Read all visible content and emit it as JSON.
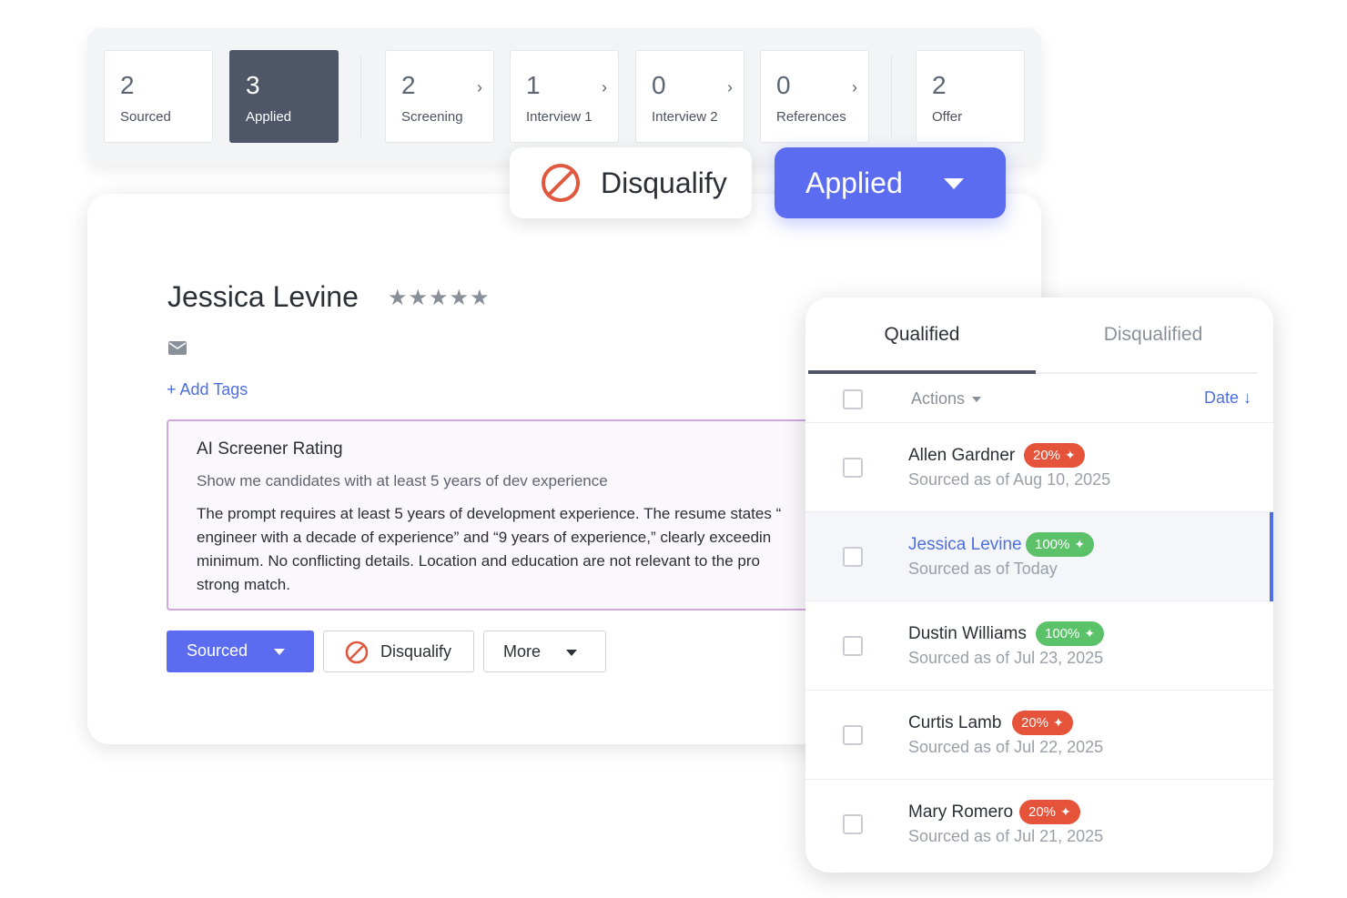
{
  "pipeline": {
    "stages": [
      {
        "count": "2",
        "label": "Sourced"
      },
      {
        "count": "3",
        "label": "Applied"
      },
      {
        "count": "2",
        "label": "Screening"
      },
      {
        "count": "1",
        "label": "Interview 1"
      },
      {
        "count": "0",
        "label": "Interview 2"
      },
      {
        "count": "0",
        "label": "References"
      },
      {
        "count": "2",
        "label": "Offer"
      }
    ],
    "chevron": "›",
    "active_stage": "Applied"
  },
  "floating": {
    "disqualify_label": "Disqualify",
    "applied_label": "Applied"
  },
  "candidate": {
    "name": "Jessica Levine",
    "stars": "★★★★★",
    "add_tags": "+ Add Tags",
    "ai": {
      "title": "AI Screener Rating",
      "prompt": "Show me candidates with at least 5 years of dev experience",
      "body": "The prompt requires at least 5 years of development experience. The resume states “\nengineer with a decade of experience” and “9 years of experience,” clearly exceedin\nminimum. No conflicting details. Location and education are not relevant to the pro\nstrong match."
    },
    "actions": {
      "sourced_label": "Sourced",
      "disqualify_label": "Disqualify",
      "more_label": "More"
    }
  },
  "list": {
    "tabs": {
      "qualified": "Qualified",
      "disqualified": "Disqualified"
    },
    "header": {
      "actions": "Actions",
      "date": "Date ↓"
    },
    "rows": [
      {
        "name": "Allen Gardner",
        "score": "20%",
        "sub": "Sourced as of Aug 10, 2025"
      },
      {
        "name": "Jessica Levine",
        "score": "100%",
        "sub": "Sourced as of Today"
      },
      {
        "name": "Dustin Williams",
        "score": "100%",
        "sub": "Sourced as of Jul 23, 2025"
      },
      {
        "name": "Curtis Lamb",
        "score": "20%",
        "sub": "Sourced as of Jul 22, 2025"
      },
      {
        "name": "Mary Romero",
        "score": "20%",
        "sub": "Sourced as of Jul 21, 2025"
      }
    ],
    "spark": "✦"
  },
  "colors": {
    "accent": "#5b6cf0",
    "link": "#4d6fe0",
    "active_stage": "#4e5668",
    "badge_low": "#e5533a",
    "badge_high": "#5cc26a",
    "disqualify_icon": "#e0583e",
    "ai_border": "#cfa9dc"
  },
  "icons": [
    "chevron-right-icon",
    "disqualify-icon",
    "caret-down-icon",
    "mail-icon",
    "star-icon",
    "sparkle-icon",
    "sort-down-arrow-icon"
  ]
}
